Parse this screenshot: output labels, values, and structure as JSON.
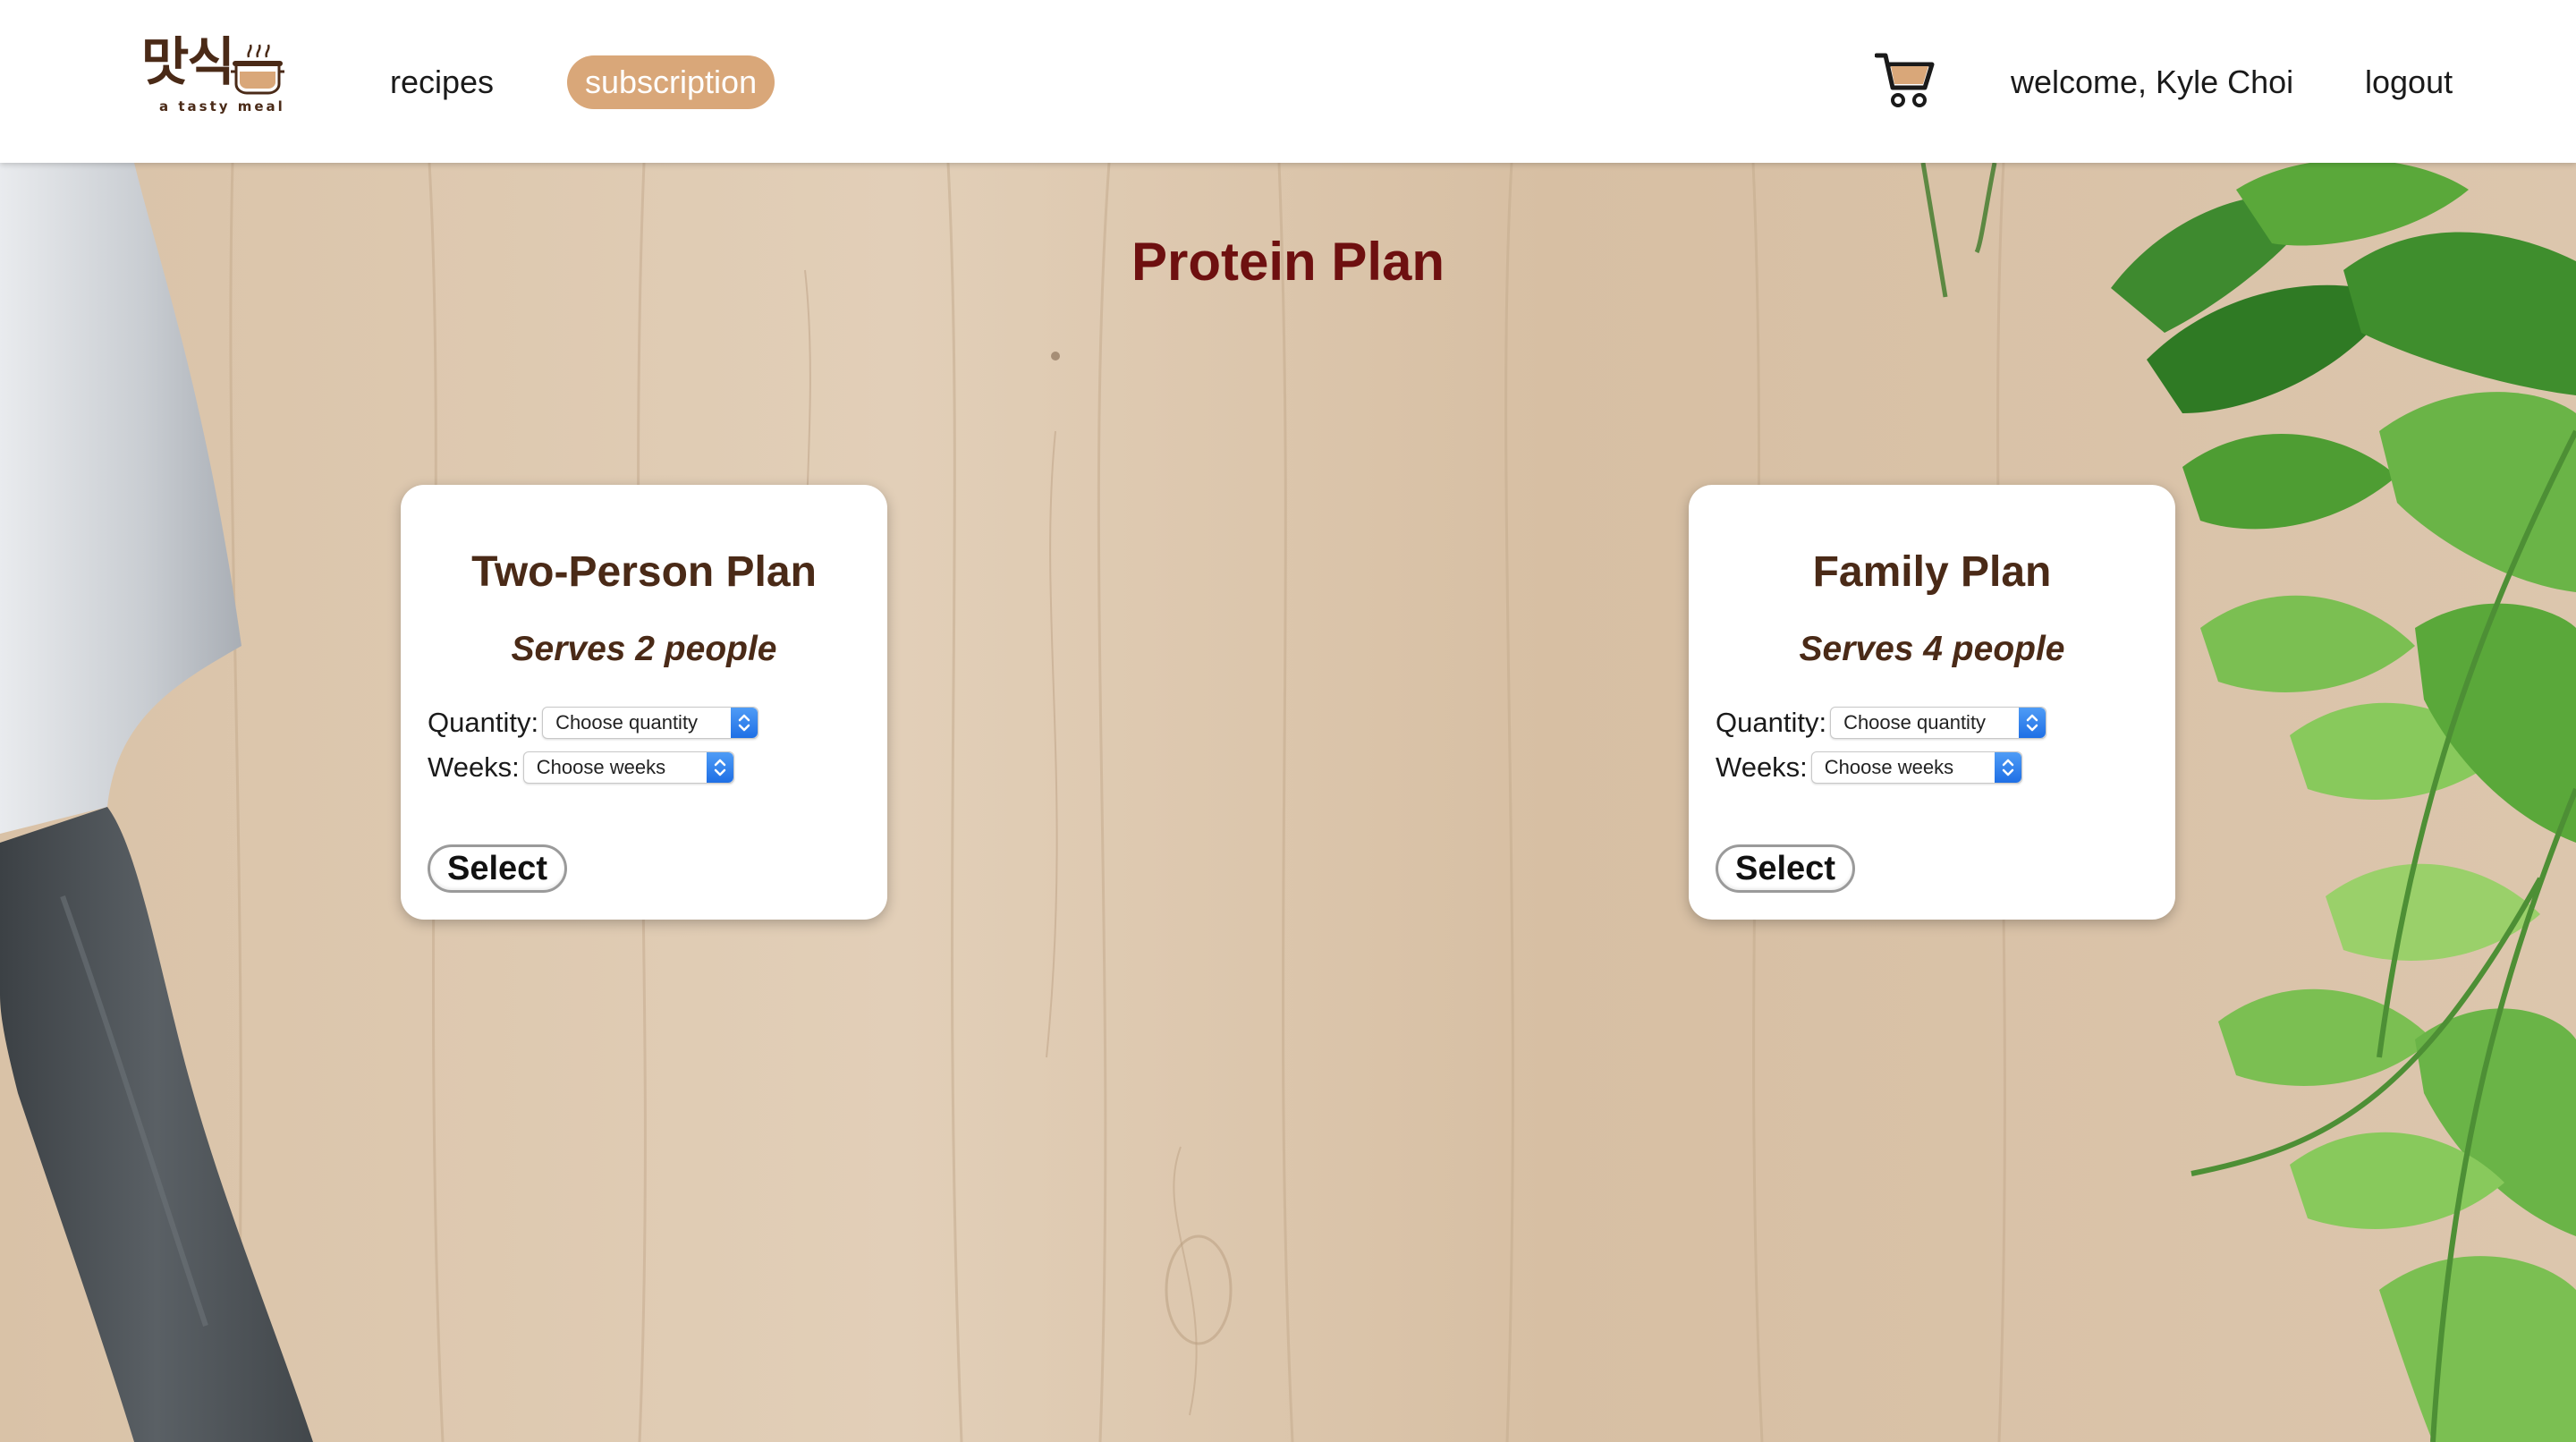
{
  "header": {
    "logo": {
      "text": "맛식",
      "tagline": "a tasty meal"
    },
    "nav": {
      "recipes_label": "recipes",
      "subscription_label": "subscription"
    },
    "cart_icon": "shopping-cart-icon",
    "welcome_text": "welcome, Kyle Choi",
    "logout_label": "logout"
  },
  "main": {
    "title": "Protein Plan",
    "plans": [
      {
        "title": "Two-Person Plan",
        "serves": "Serves 2 people",
        "quantity_label": "Quantity:",
        "quantity_value": "Choose quantity",
        "weeks_label": "Weeks:",
        "weeks_value": "Choose weeks",
        "button_label": "Select"
      },
      {
        "title": "Family Plan",
        "serves": "Serves 4 people",
        "quantity_label": "Quantity:",
        "quantity_value": "Choose quantity",
        "weeks_label": "Weeks:",
        "weeks_value": "Choose weeks",
        "button_label": "Select"
      }
    ]
  },
  "colors": {
    "subscription_pill": "#d9a779",
    "title": "#6e1010",
    "card_text": "#4a2a17",
    "background_wood": "#ddc7ae"
  }
}
